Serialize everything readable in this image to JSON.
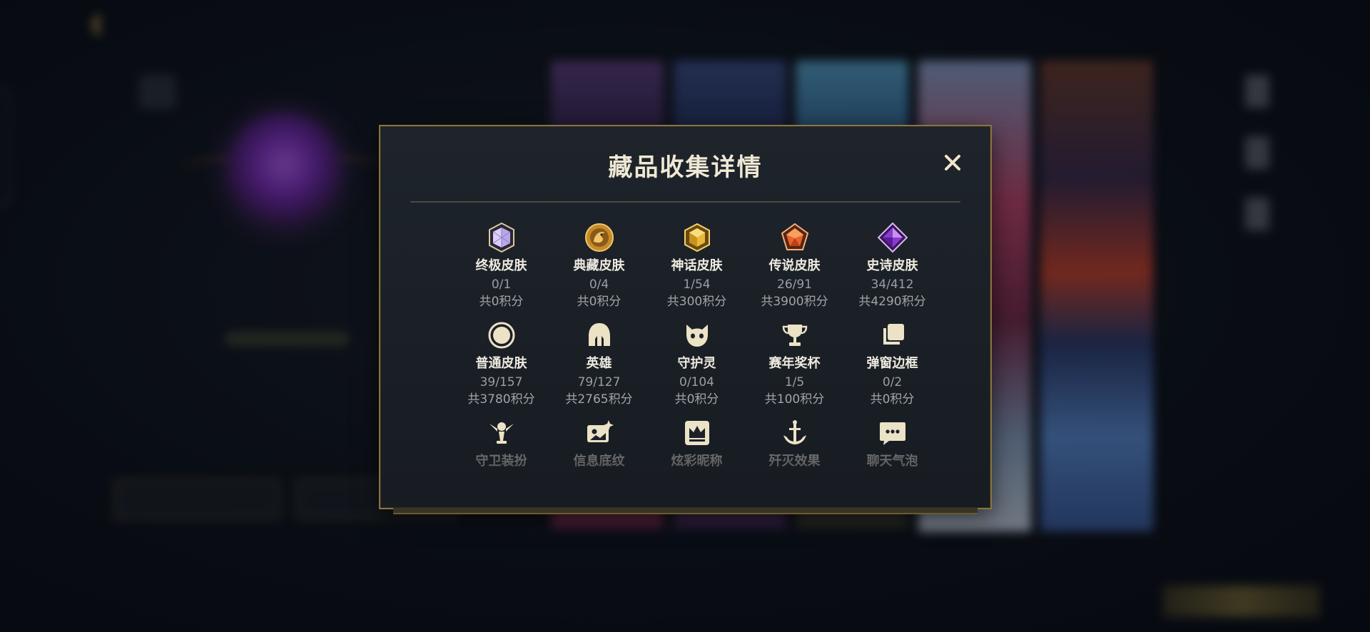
{
  "modal": {
    "title": "藏品收集详情",
    "close_icon": "close-icon",
    "rows": [
      [
        {
          "label": "终极皮肤",
          "count": "0/1",
          "points": "共0积分",
          "icon": "crystal-gem-icon"
        },
        {
          "label": "典藏皮肤",
          "count": "0/4",
          "points": "共0积分",
          "icon": "dragon-medallion-icon"
        },
        {
          "label": "神话皮肤",
          "count": "1/54",
          "points": "共300积分",
          "icon": "gold-hexagon-gem-icon"
        },
        {
          "label": "传说皮肤",
          "count": "26/91",
          "points": "共3900积分",
          "icon": "orange-pentagon-gem-icon"
        },
        {
          "label": "史诗皮肤",
          "count": "34/412",
          "points": "共4290积分",
          "icon": "purple-diamond-gem-icon"
        }
      ],
      [
        {
          "label": "普通皮肤",
          "count": "39/157",
          "points": "共3780积分",
          "icon": "circle-icon"
        },
        {
          "label": "英雄",
          "count": "79/127",
          "points": "共2765积分",
          "icon": "helmet-icon"
        },
        {
          "label": "守护灵",
          "count": "0/104",
          "points": "共0积分",
          "icon": "guardian-face-icon"
        },
        {
          "label": "赛年奖杯",
          "count": "1/5",
          "points": "共100积分",
          "icon": "trophy-icon"
        },
        {
          "label": "弹窗边框",
          "count": "0/2",
          "points": "共0积分",
          "icon": "stacked-frames-icon"
        }
      ],
      [
        {
          "label": "守卫装扮",
          "icon": "ward-icon"
        },
        {
          "label": "信息底纹",
          "icon": "image-sparkle-icon"
        },
        {
          "label": "炫彩昵称",
          "icon": "crown-card-icon"
        },
        {
          "label": "歼灭效果",
          "icon": "anchor-sword-icon"
        },
        {
          "label": "聊天气泡",
          "icon": "chat-bubble-icon"
        }
      ]
    ]
  },
  "colors": {
    "accent_gold": "#c8a24a",
    "modal_border": "#8a7441",
    "title_text": "#efe8d4",
    "count_text": "#9c9ea3"
  }
}
